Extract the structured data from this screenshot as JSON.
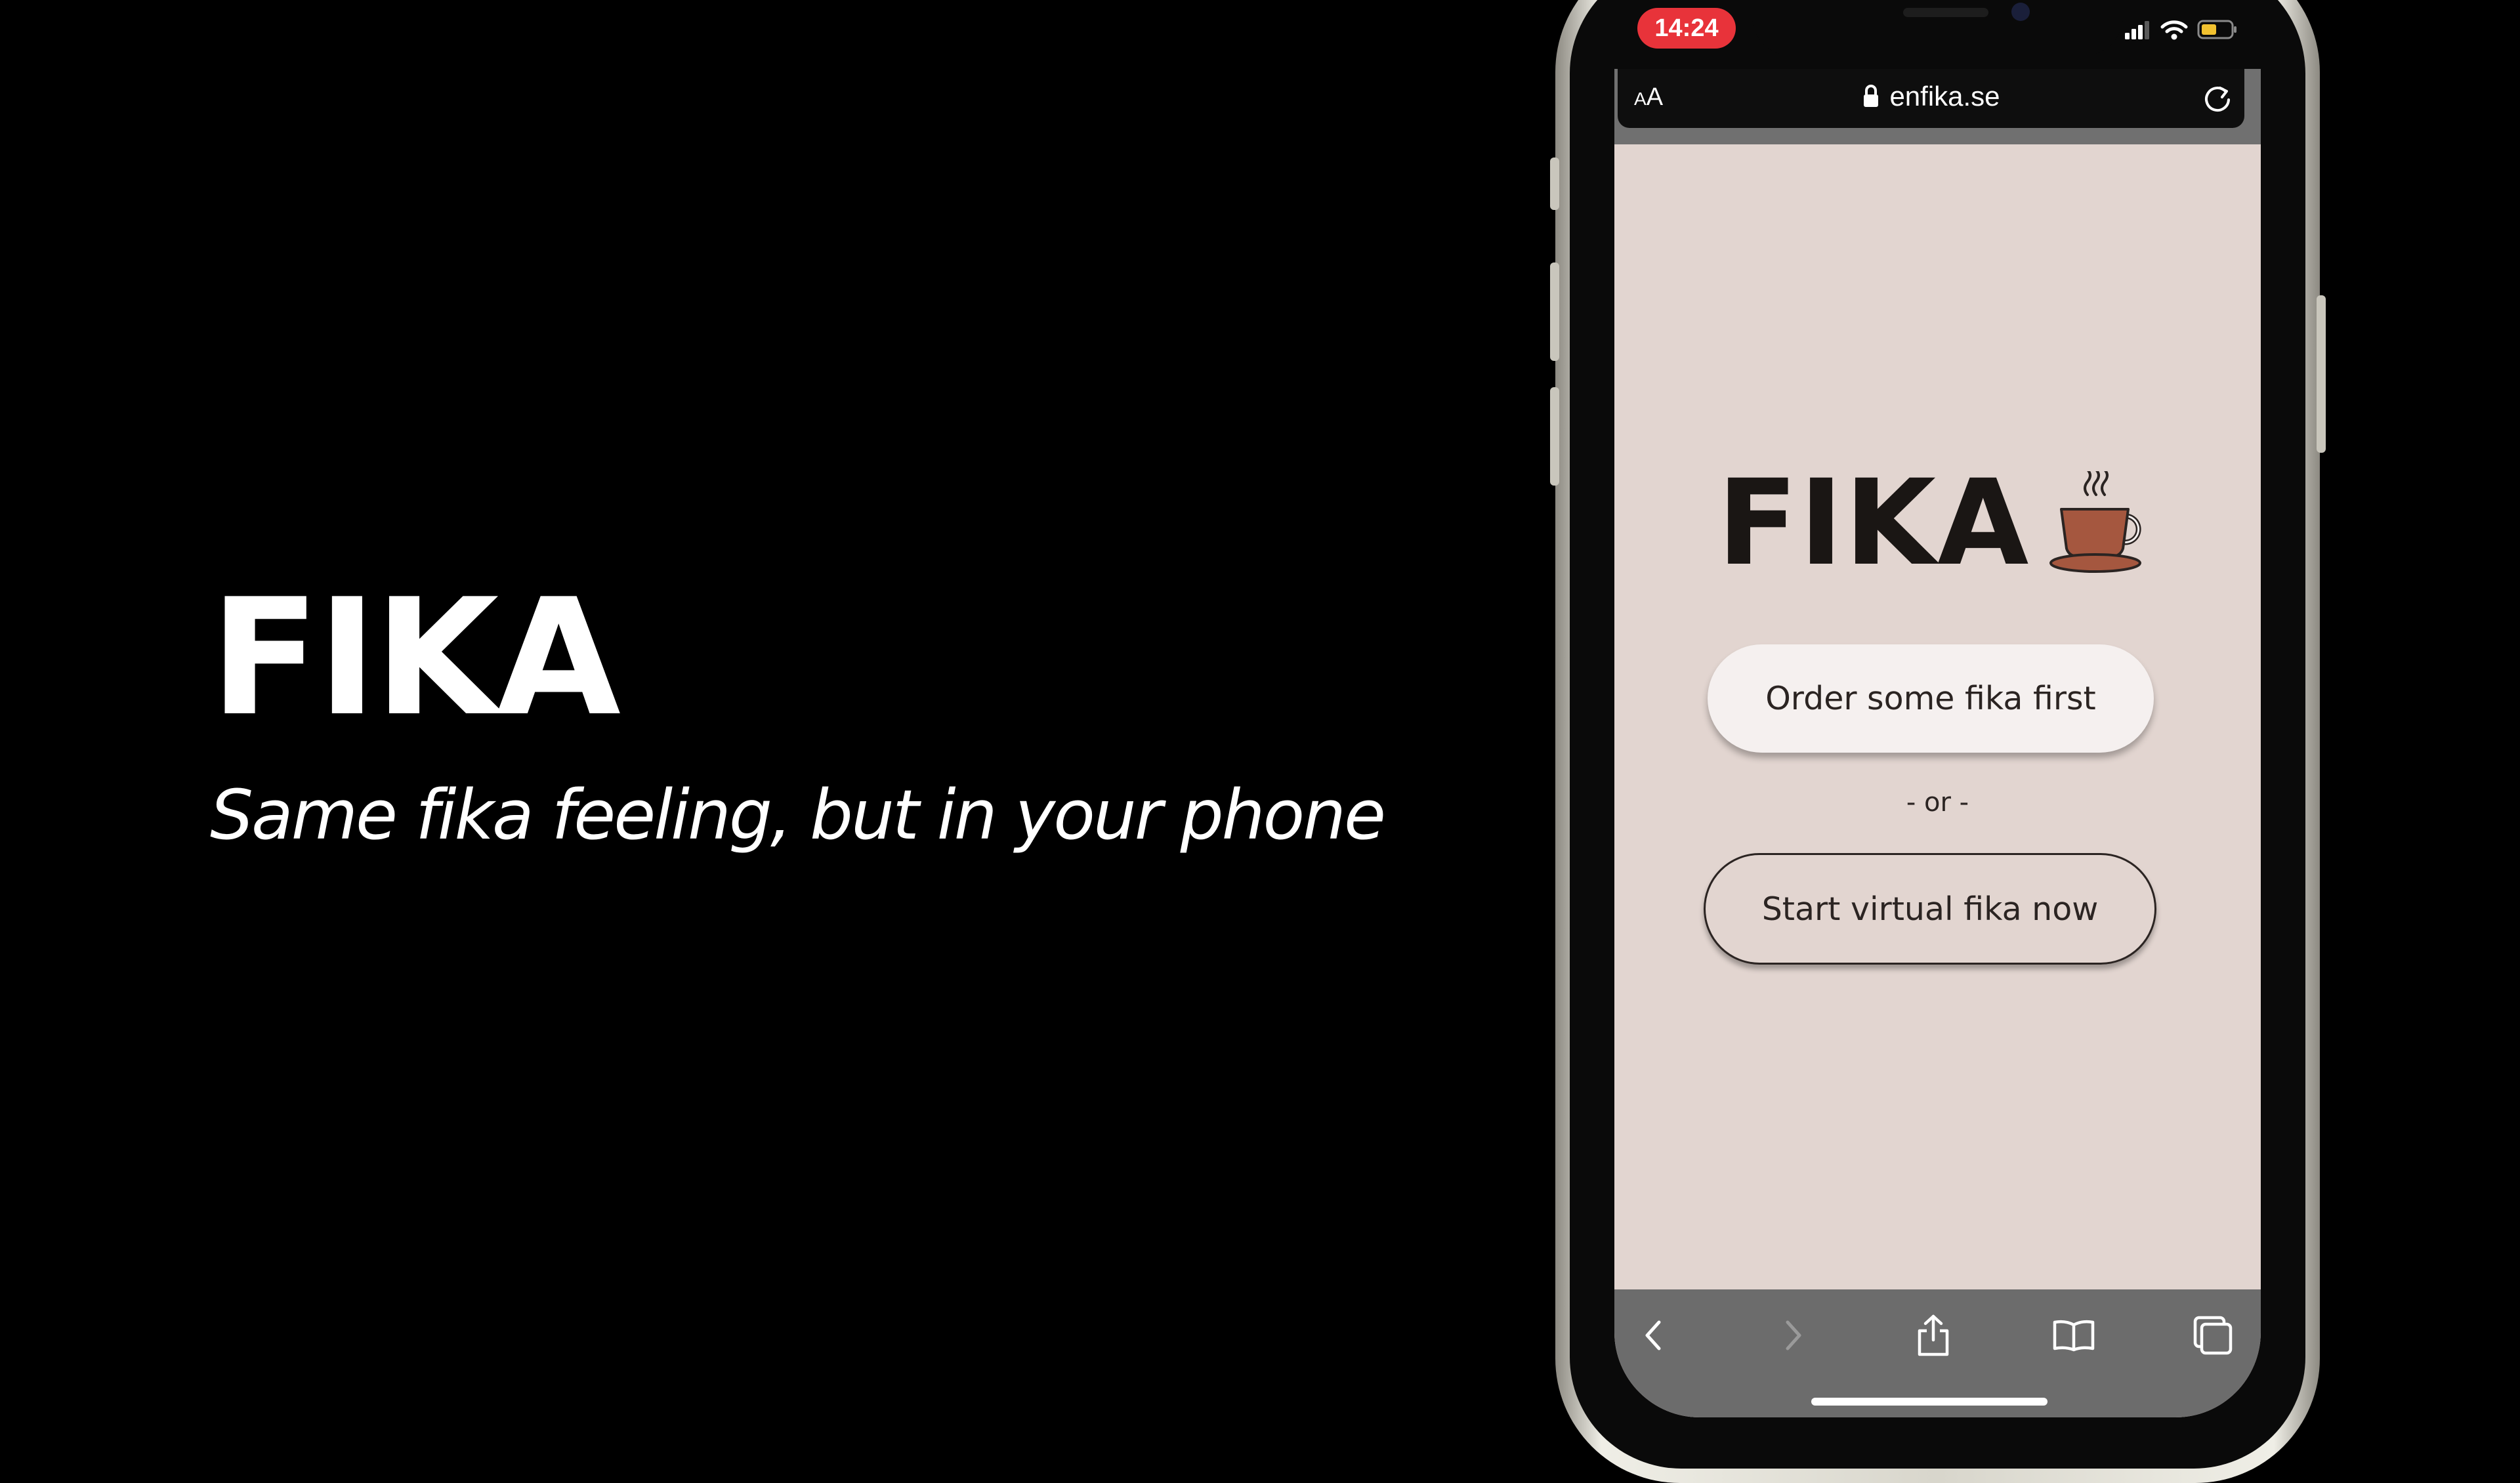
{
  "slide": {
    "title": "FIKA",
    "subtitle": "Same fika feeling, but in your phone"
  },
  "status_bar": {
    "time": "14:24",
    "icons": [
      "signal-icon",
      "wifi-icon",
      "battery-icon"
    ]
  },
  "browser": {
    "text_size_label_small": "A",
    "text_size_label_large": "A",
    "url": "enfika.se",
    "icons": [
      "lock-icon",
      "reload-icon"
    ],
    "toolbar": [
      "back-icon",
      "forward-icon",
      "share-icon",
      "bookmarks-icon",
      "tabs-icon"
    ]
  },
  "page": {
    "brand": "FIKA",
    "brand_icon": "coffee-cup-icon",
    "order_button_label": "Order some fika first",
    "separator": "- or -",
    "start_button_label": "Start virtual fika now"
  },
  "colors": {
    "background": "#000000",
    "page_background": "#e2d5d0",
    "order_button": "#f5f0ef",
    "time_pill": "#e8333a",
    "cup": "#a5573f",
    "browser_toolbar": "#6c6c6c"
  }
}
